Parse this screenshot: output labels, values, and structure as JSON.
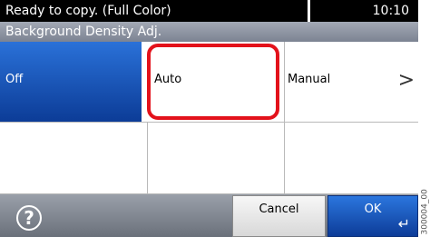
{
  "status": {
    "message": "Ready to copy. (Full Color)",
    "time": "10:10"
  },
  "title": "Background Density Adj.",
  "options": [
    {
      "label": "Off",
      "selected": true
    },
    {
      "label": "Auto",
      "selected": false
    },
    {
      "label": "Manual",
      "selected": false
    }
  ],
  "manual_chevron": ">",
  "help_symbol": "?",
  "buttons": {
    "cancel": "Cancel",
    "ok": "OK"
  },
  "enter_symbol": "↵",
  "side_code": "300004_00",
  "colors": {
    "selected_option": "#1a56c0",
    "highlight_border": "#e3121b",
    "status_bar": "#000000",
    "ok_button": "#1a56c0"
  },
  "icons": [
    "help-icon",
    "chevron-right-icon",
    "enter-icon"
  ]
}
